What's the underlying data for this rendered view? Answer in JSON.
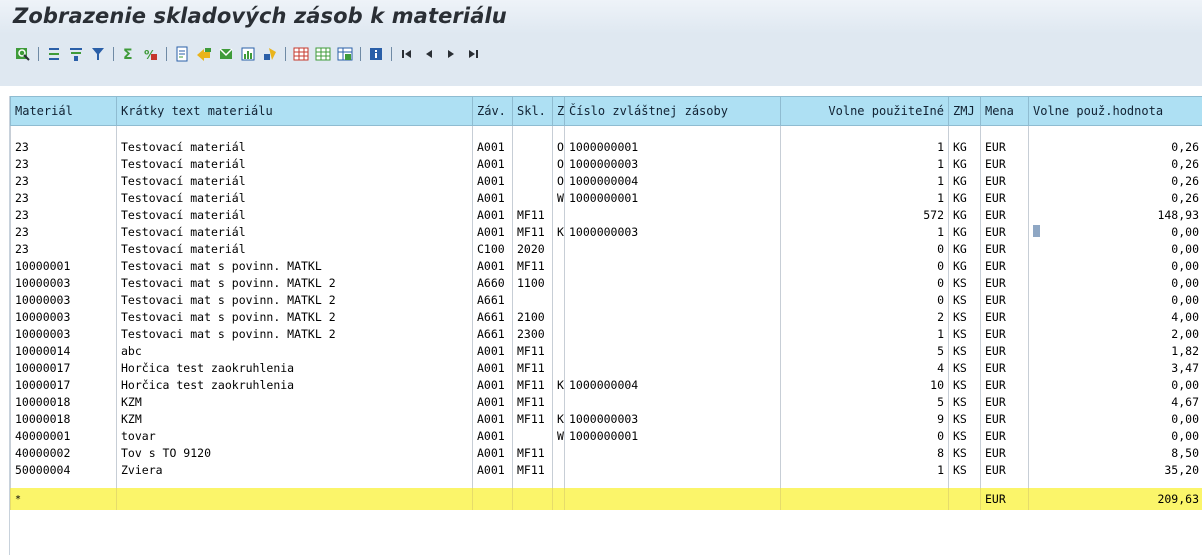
{
  "header": {
    "title": "Zobrazenie skladových zásob k materiálu"
  },
  "toolbar": {
    "icons": [
      "details-icon",
      "sort-ascending-icon",
      "sort-descending-icon",
      "filter-icon",
      "sum-icon",
      "subtotal-icon",
      "print-preview-icon",
      "export-icon",
      "send-icon",
      "graphic-icon",
      "abc-analysis-icon",
      "change-layout-icon",
      "select-layout-icon",
      "save-layout-icon",
      "info-icon",
      "first-page-icon",
      "previous-page-icon",
      "next-page-icon",
      "last-page-icon"
    ],
    "colors": {
      "bg": "#dfe8f1",
      "icon_blue": "#2a5fa8",
      "icon_green": "#3f9b3a",
      "icon_red": "#c6372c",
      "icon_yellow": "#e9b41c"
    }
  },
  "table": {
    "columns": [
      "Materiál",
      "Krátky text materiálu",
      "Záv.",
      "Skl.",
      "Z",
      "Číslo zvláštnej zásoby",
      "Volne použiteIné",
      "ZMJ",
      "Mena",
      "Volne použ.hodnota"
    ],
    "rows": [
      [
        "23",
        "Testovací materiál",
        "A001",
        "",
        "O",
        "1000000001",
        "1",
        "KG",
        "EUR",
        "0,26"
      ],
      [
        "23",
        "Testovací materiál",
        "A001",
        "",
        "O",
        "1000000003",
        "1",
        "KG",
        "EUR",
        "0,26"
      ],
      [
        "23",
        "Testovací materiál",
        "A001",
        "",
        "O",
        "1000000004",
        "1",
        "KG",
        "EUR",
        "0,26"
      ],
      [
        "23",
        "Testovací materiál",
        "A001",
        "",
        "W",
        "1000000001",
        "1",
        "KG",
        "EUR",
        "0,26"
      ],
      [
        "23",
        "Testovací materiál",
        "A001",
        "MF11",
        "",
        "",
        "572",
        "KG",
        "EUR",
        "148,93"
      ],
      [
        "23",
        "Testovací materiál",
        "A001",
        "MF11",
        "K",
        "1000000003",
        "1",
        "KG",
        "EUR",
        "0,00"
      ],
      [
        "23",
        "Testovací materiál",
        "C100",
        "2020",
        "",
        "",
        "0",
        "KG",
        "EUR",
        "0,00"
      ],
      [
        "10000001",
        "Testovaci mat s povinn. MATKL",
        "A001",
        "MF11",
        "",
        "",
        "0",
        "KG",
        "EUR",
        "0,00"
      ],
      [
        "10000003",
        "Testovaci mat s povinn. MATKL 2",
        "A660",
        "1100",
        "",
        "",
        "0",
        "KS",
        "EUR",
        "0,00"
      ],
      [
        "10000003",
        "Testovaci mat s povinn. MATKL 2",
        "A661",
        "",
        "",
        "",
        "0",
        "KS",
        "EUR",
        "0,00"
      ],
      [
        "10000003",
        "Testovaci mat s povinn. MATKL 2",
        "A661",
        "2100",
        "",
        "",
        "2",
        "KS",
        "EUR",
        "4,00"
      ],
      [
        "10000003",
        "Testovaci mat s povinn. MATKL 2",
        "A661",
        "2300",
        "",
        "",
        "1",
        "KS",
        "EUR",
        "2,00"
      ],
      [
        "10000014",
        "abc",
        "A001",
        "MF11",
        "",
        "",
        "5",
        "KS",
        "EUR",
        "1,82"
      ],
      [
        "10000017",
        "Horčica test zaokruhlenia",
        "A001",
        "MF11",
        "",
        "",
        "4",
        "KS",
        "EUR",
        "3,47"
      ],
      [
        "10000017",
        "Horčica test zaokruhlenia",
        "A001",
        "MF11",
        "K",
        "1000000004",
        "10",
        "KS",
        "EUR",
        "0,00"
      ],
      [
        "10000018",
        "KZM",
        "A001",
        "MF11",
        "",
        "",
        "5",
        "KS",
        "EUR",
        "4,67"
      ],
      [
        "10000018",
        "KZM",
        "A001",
        "MF11",
        "K",
        "1000000003",
        "9",
        "KS",
        "EUR",
        "0,00"
      ],
      [
        "40000001",
        "tovar",
        "A001",
        "",
        "W",
        "1000000001",
        "0",
        "KS",
        "EUR",
        "0,00"
      ],
      [
        "40000002",
        "Tov s TO 9120",
        "A001",
        "MF11",
        "",
        "",
        "8",
        "KS",
        "EUR",
        "8,50"
      ],
      [
        "50000004",
        "Zviera",
        "A001",
        "MF11",
        "",
        "",
        "1",
        "KS",
        "EUR",
        "35,20"
      ]
    ],
    "total": {
      "marker": "*",
      "currency": "EUR",
      "value": "209,63"
    },
    "colors": {
      "header_bg": "#aee0f3",
      "total_bg": "#fbf56a",
      "selection": "#8fa7c4"
    }
  }
}
